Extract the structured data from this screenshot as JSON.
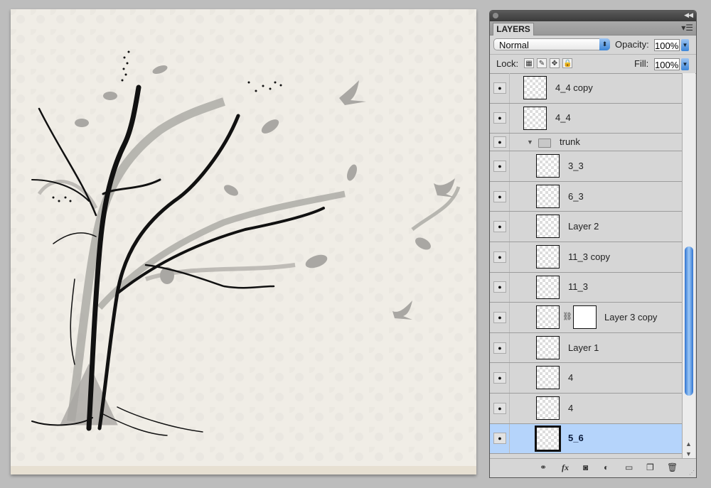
{
  "panel": {
    "tab_label": "LAYERS",
    "collapse_icon": "double-chevron-icon",
    "menu_icon": "panel-menu-icon",
    "blend_mode": "Normal",
    "opacity_label": "Opacity:",
    "opacity_value": "100%",
    "lock_label": "Lock:",
    "lock_icons": [
      "lock-transparent-pixels-icon",
      "lock-image-pixels-icon",
      "lock-position-icon",
      "lock-all-icon"
    ],
    "fill_label": "Fill:",
    "fill_value": "100%"
  },
  "layers": [
    {
      "name": "4_4 copy",
      "type": "layer",
      "indent": 0,
      "visible": true,
      "selected": false
    },
    {
      "name": "4_4",
      "type": "layer",
      "indent": 0,
      "visible": true,
      "selected": false
    },
    {
      "name": "trunk",
      "type": "group",
      "indent": 0,
      "visible": true,
      "selected": false,
      "expanded": true
    },
    {
      "name": "3_3",
      "type": "layer",
      "indent": 1,
      "visible": true,
      "selected": false
    },
    {
      "name": "6_3",
      "type": "layer",
      "indent": 1,
      "visible": true,
      "selected": false
    },
    {
      "name": "Layer 2",
      "type": "layer",
      "indent": 1,
      "visible": true,
      "selected": false
    },
    {
      "name": "11_3 copy",
      "type": "layer",
      "indent": 1,
      "visible": true,
      "selected": false
    },
    {
      "name": "11_3",
      "type": "layer",
      "indent": 1,
      "visible": true,
      "selected": false
    },
    {
      "name": "Layer 3 copy",
      "type": "layer",
      "indent": 1,
      "visible": true,
      "selected": false,
      "has_mask": true
    },
    {
      "name": "Layer 1",
      "type": "layer",
      "indent": 1,
      "visible": true,
      "selected": false
    },
    {
      "name": "4",
      "type": "layer",
      "indent": 1,
      "visible": true,
      "selected": false
    },
    {
      "name": "4",
      "type": "layer",
      "indent": 1,
      "visible": true,
      "selected": false
    },
    {
      "name": "5_6",
      "type": "layer",
      "indent": 1,
      "visible": true,
      "selected": true
    }
  ],
  "bottom_toolbar": [
    {
      "icon": "link-layers-icon",
      "glyph": "⚭"
    },
    {
      "icon": "layer-style-fx-icon",
      "glyph": "fx"
    },
    {
      "icon": "add-mask-icon",
      "glyph": "◙"
    },
    {
      "icon": "adjustment-layer-icon",
      "glyph": "◐"
    },
    {
      "icon": "new-group-icon",
      "glyph": "▭"
    },
    {
      "icon": "new-layer-icon",
      "glyph": "❐"
    },
    {
      "icon": "delete-layer-icon",
      "glyph": "🗑"
    }
  ],
  "canvas": {
    "description": "Artwork of a scribbled black tree with grey swirl branches, leaves and birds on a cream patterned paper",
    "paper_color": "#f0ede6",
    "ink_color": "#111111",
    "shadow_color": "#a8a6a2"
  },
  "colors": {
    "selection": "#b5d4fb",
    "accent_blue": "#3d86d8",
    "panel_bg": "#d6d6d6",
    "workspace_bg": "#bdbdbd"
  }
}
